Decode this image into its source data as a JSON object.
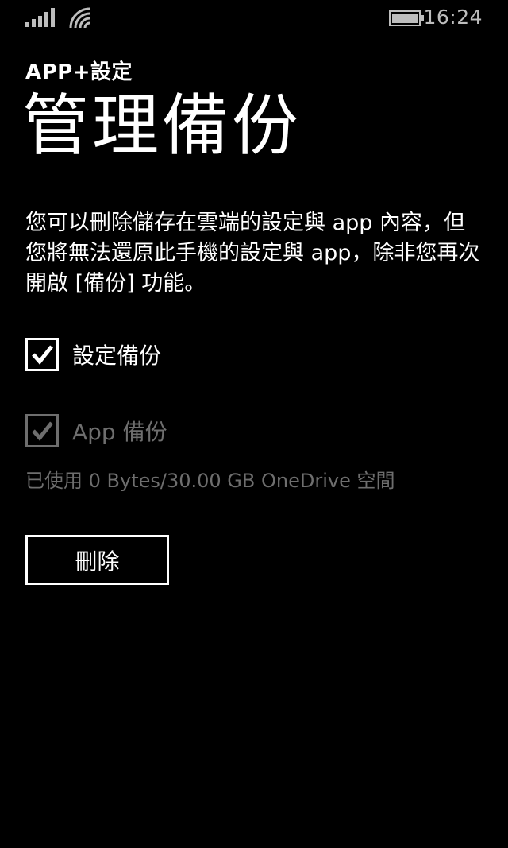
{
  "status_bar": {
    "time": "16:24",
    "icons": [
      "signal-icon",
      "wifi-icon",
      "battery-icon"
    ]
  },
  "header": {
    "app_title": "APP+設定",
    "page_title": "管理備份"
  },
  "description": "您可以刪除儲存在雲端的設定與 app 內容，但您將無法還原此手機的設定與 app，除非您再次開啟 [備份] 功能。",
  "options": [
    {
      "label": "設定備份",
      "checked": true,
      "enabled": true
    },
    {
      "label": "App 備份",
      "checked": true,
      "enabled": false
    }
  ],
  "usage_text": "已使用 0 Bytes/30.00 GB OneDrive 空間",
  "delete_button_label": "刪除",
  "colors": {
    "background": "#000000",
    "foreground": "#ffffff",
    "disabled": "#6e6e6e"
  }
}
